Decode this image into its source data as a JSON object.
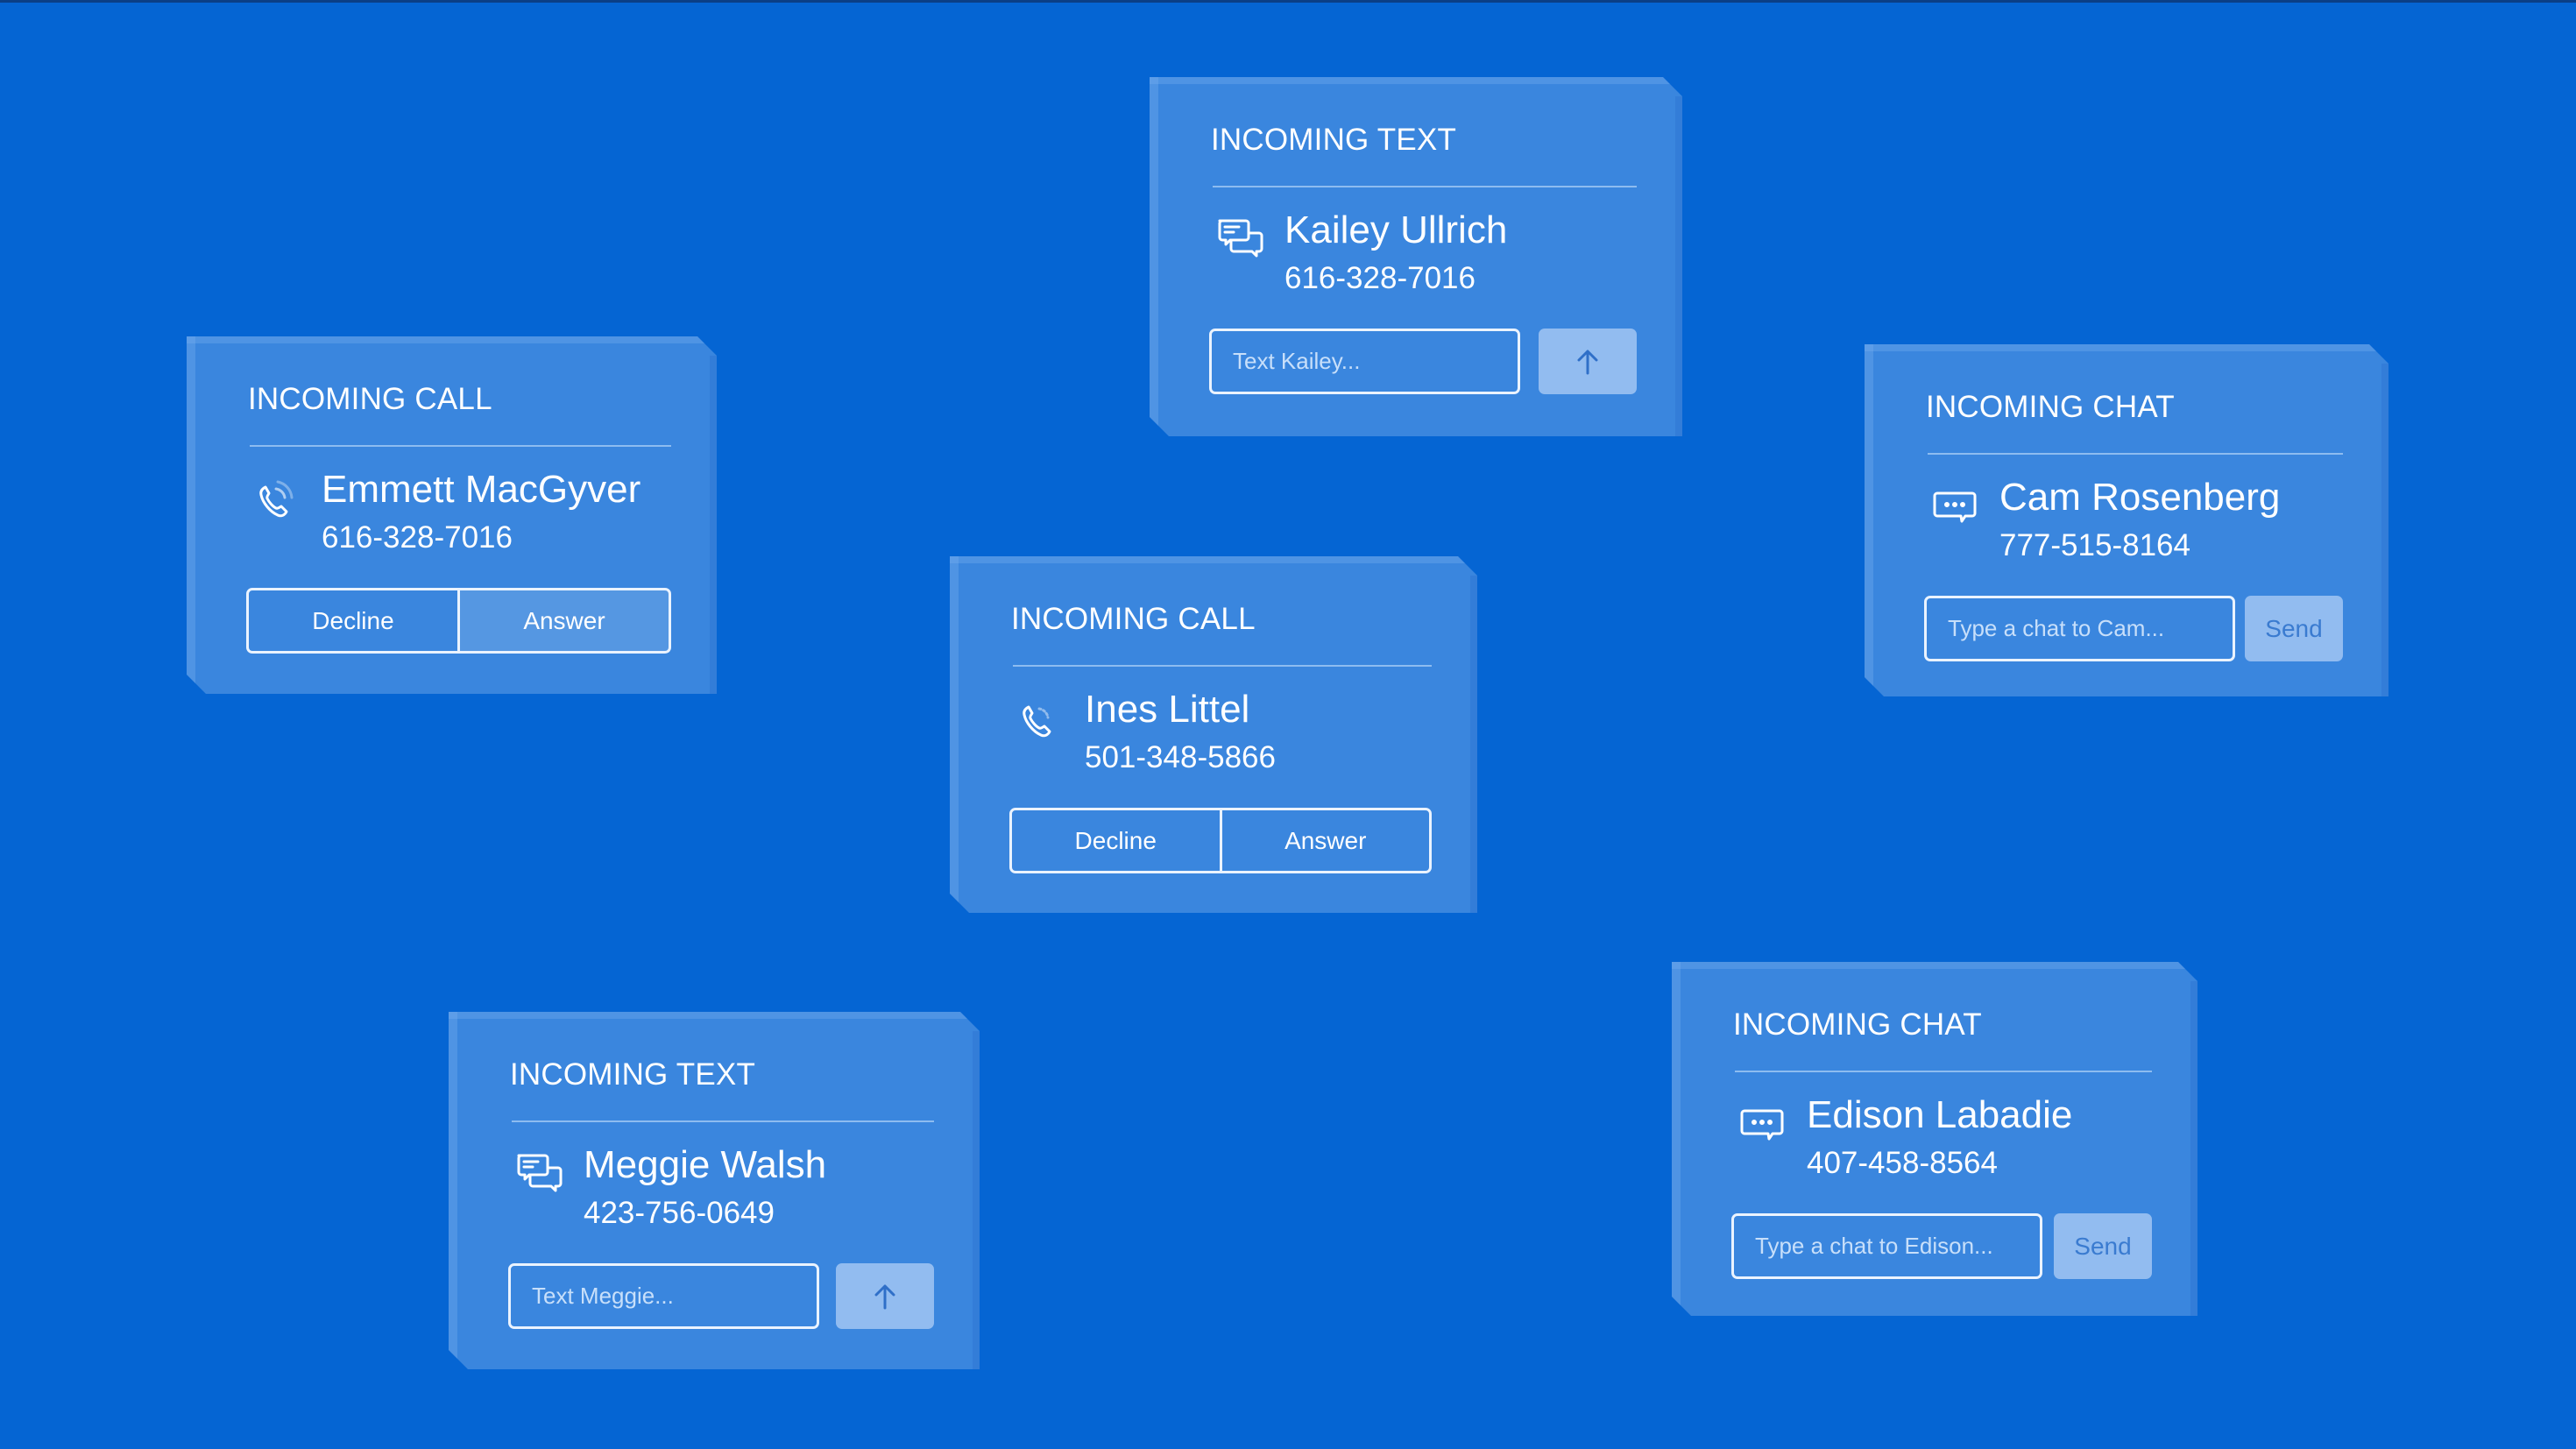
{
  "colors": {
    "background": "#0565d3",
    "card": "#3a86de",
    "text": "#ffffff",
    "send_button": "#92bcf0",
    "send_text": "#3a7bd0"
  },
  "cards": [
    {
      "type": "text",
      "title": "INCOMING TEXT",
      "icon": "chat-bubbles-icon",
      "name": "Kailey Ullrich",
      "phone": "616-328-7016",
      "input_placeholder": "Text Kailey...",
      "input_value": "",
      "send_icon": "arrow-up-icon"
    },
    {
      "type": "call",
      "title": "INCOMING CALL",
      "icon": "phone-ringing-icon",
      "name": "Emmett MacGyver",
      "phone": "616-328-7016",
      "decline_label": "Decline",
      "answer_label": "Answer",
      "answer_hovered": true
    },
    {
      "type": "chat",
      "title": "INCOMING CHAT",
      "icon": "chat-dots-icon",
      "name": "Cam Rosenberg",
      "phone": "777-515-8164",
      "input_placeholder": "Type a chat to Cam...",
      "input_value": "",
      "send_label": "Send"
    },
    {
      "type": "call",
      "title": "INCOMING CALL",
      "icon": "phone-ringing-icon",
      "name": "Ines Littel",
      "phone": "501-348-5866",
      "decline_label": "Decline",
      "answer_label": "Answer",
      "answer_hovered": false
    },
    {
      "type": "text",
      "title": "INCOMING TEXT",
      "icon": "chat-bubbles-icon",
      "name": "Meggie Walsh",
      "phone": "423-756-0649",
      "input_placeholder": "Text Meggie...",
      "input_value": "",
      "send_icon": "arrow-up-icon"
    },
    {
      "type": "chat",
      "title": "INCOMING CHAT",
      "icon": "chat-dots-icon",
      "name": "Edison Labadie",
      "phone": "407-458-8564",
      "input_placeholder": "Type a chat to Edison...",
      "input_value": "",
      "send_label": "Send"
    }
  ]
}
